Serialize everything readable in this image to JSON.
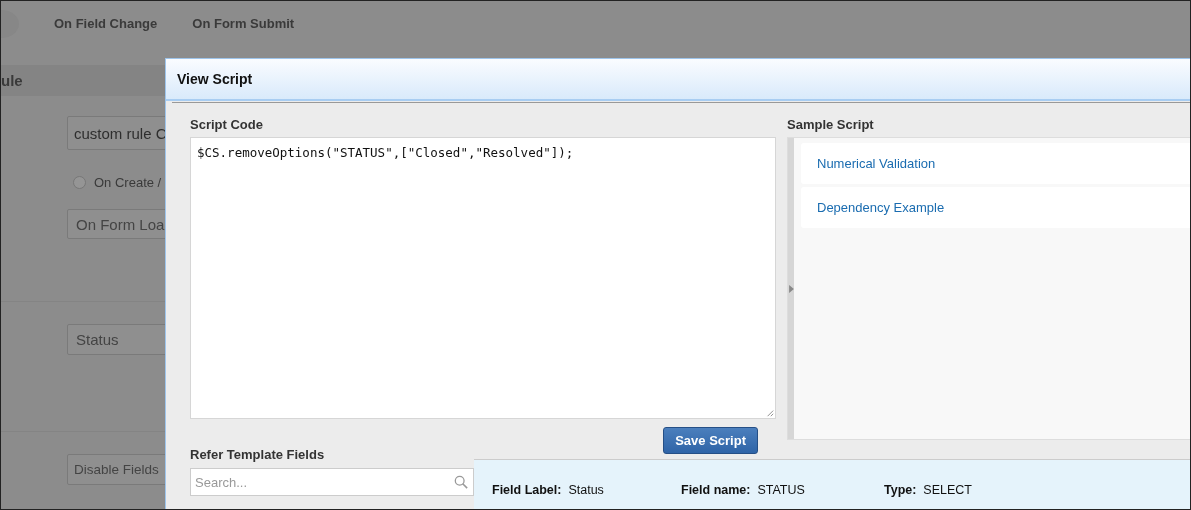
{
  "background": {
    "tabs": [
      {
        "label": "On Field Change"
      },
      {
        "label": "On Form Submit"
      }
    ],
    "section_title": "ule",
    "rule_name": "custom rule C",
    "radio": {
      "label": "On Create /",
      "checked": false
    },
    "event_select": "On Form Loa",
    "field_select": "Status",
    "action_select": "Disable Fields"
  },
  "dialog": {
    "title": "View Script",
    "script_code": {
      "label": "Script Code",
      "value": "$CS.removeOptions(\"STATUS\",[\"Closed\",\"Resolved\"]);"
    },
    "save_button": "Save Script",
    "sample_script": {
      "label": "Sample Script",
      "items": [
        "Numerical Validation",
        "Dependency Example"
      ]
    },
    "refer": {
      "label": "Refer Template Fields",
      "search_placeholder": "Search..."
    },
    "field_info": [
      {
        "label": "Field Label:",
        "value": "Status"
      },
      {
        "label": "Field name:",
        "value": "STATUS"
      },
      {
        "label": "Type:",
        "value": "SELECT"
      }
    ]
  }
}
